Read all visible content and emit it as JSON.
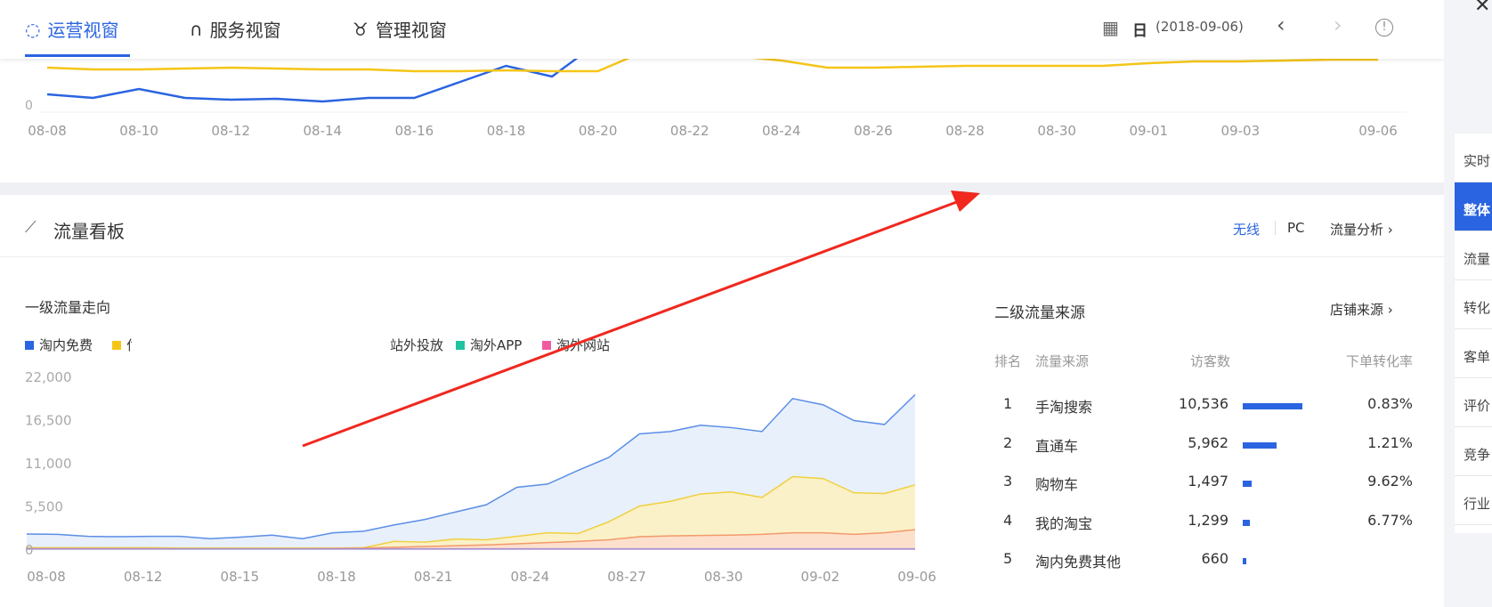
{
  "tabs": [
    {
      "label": "运营视窗",
      "icon": "refresh-circle-icon"
    },
    {
      "label": "服务视窗",
      "icon": "headset-icon"
    },
    {
      "label": "管理视窗",
      "icon": "tie-icon"
    }
  ],
  "date": {
    "period": "日",
    "value": "(2018-09-06)",
    "icon": "calendar-icon"
  },
  "close_icon": "close-icon",
  "top_chart": {
    "type": "line",
    "zero_label": "0",
    "x_labels": [
      "08-08",
      "08-10",
      "08-12",
      "08-14",
      "08-16",
      "08-18",
      "08-20",
      "08-22",
      "08-24",
      "08-26",
      "08-28",
      "08-30",
      "09-01",
      "09-03",
      "09-06"
    ],
    "series": [
      {
        "name": "blue",
        "color": "#2a64e0",
        "values": [
          12,
          8,
          18,
          8,
          6,
          7,
          4,
          8,
          8,
          26,
          44,
          32,
          70,
          90,
          90,
          90,
          90,
          90,
          90,
          90,
          90,
          90,
          90,
          90,
          90,
          90,
          90,
          90,
          90,
          90
        ]
      },
      {
        "name": "yellow",
        "color": "#f5c518",
        "values": [
          42,
          40,
          40,
          41,
          42,
          41,
          40,
          40,
          38,
          38,
          39,
          38,
          38,
          60,
          58,
          55,
          50,
          42,
          42,
          43,
          44,
          44,
          44,
          44,
          47,
          49,
          49,
          50,
          51,
          51
        ]
      }
    ],
    "ylim": [
      0,
      60
    ]
  },
  "section": {
    "title": "流量看板",
    "wireless": "无线",
    "pc": "PC",
    "analysis": "流量分析 ›"
  },
  "chart_data": {
    "type": "area",
    "title": "一级流量走向",
    "legend": [
      {
        "label": "淘内免费",
        "color": "#2a64e0"
      },
      {
        "label": "付",
        "color": "#f5c518"
      },
      {
        "label": "站外投放",
        "color": "#f08a4b"
      },
      {
        "label": "淘外APP",
        "color": "#1ec4a0"
      },
      {
        "label": "淘外网站",
        "color": "#f05aa0"
      }
    ],
    "yticks": [
      "22,000",
      "16,500",
      "11,000",
      "5,500",
      "0"
    ],
    "ylim": [
      0,
      22000
    ],
    "xticks": [
      "08-08",
      "08-12",
      "08-15",
      "08-18",
      "08-21",
      "08-24",
      "08-27",
      "08-30",
      "09-02",
      "09-06"
    ],
    "series": [
      {
        "name": "淘内免费",
        "color": "#5b8ee6",
        "fill": "#e8f0fb",
        "values": [
          2040,
          2000,
          1750,
          1700,
          1750,
          1750,
          1450,
          1650,
          1900,
          1450,
          2200,
          2400,
          3200,
          3900,
          4850,
          5770,
          8000,
          8400,
          10150,
          11800,
          14800,
          15100,
          15900,
          15600,
          15100,
          19300,
          18500,
          16500,
          16000,
          19800
        ]
      },
      {
        "name": "付费",
        "color": "#f0d040",
        "fill": "#fbf1c8",
        "values": [
          300,
          300,
          300,
          300,
          300,
          250,
          250,
          250,
          250,
          250,
          250,
          300,
          1100,
          1000,
          1400,
          1300,
          1750,
          2200,
          2100,
          3600,
          5600,
          6200,
          7150,
          7400,
          6700,
          9350,
          9100,
          7300,
          7200,
          8300
        ]
      },
      {
        "name": "站外投放",
        "color": "#f29a6a",
        "fill": "#fde0cc",
        "values": [
          200,
          200,
          200,
          200,
          200,
          150,
          150,
          150,
          150,
          150,
          200,
          250,
          350,
          450,
          550,
          650,
          800,
          950,
          1100,
          1300,
          1700,
          1800,
          1850,
          1900,
          2000,
          2200,
          2200,
          2000,
          2200,
          2600
        ]
      },
      {
        "name": "淘外网站",
        "color": "#a890d0",
        "fill": "#d8cdea",
        "values": [
          150,
          150,
          150,
          150,
          150,
          150,
          150,
          150,
          150,
          150,
          150,
          150,
          150,
          150,
          150,
          150,
          150,
          150,
          150,
          150,
          150,
          150,
          150,
          150,
          150,
          150,
          150,
          150,
          150,
          150
        ]
      }
    ]
  },
  "sources": {
    "title": "二级流量来源",
    "link": "店铺来源 ›",
    "headers": [
      "排名",
      "流量来源",
      "访客数",
      "下单转化率"
    ],
    "rows": [
      {
        "rank": "1",
        "name": "手淘搜索",
        "visitors": "10,536",
        "v": 10536,
        "rate": "0.83%"
      },
      {
        "rank": "2",
        "name": "直通车",
        "visitors": "5,962",
        "v": 5962,
        "rate": "1.21%"
      },
      {
        "rank": "3",
        "name": "购物车",
        "visitors": "1,497",
        "v": 1497,
        "rate": "9.62%"
      },
      {
        "rank": "4",
        "name": "我的淘宝",
        "visitors": "1,299",
        "v": 1299,
        "rate": "6.77%"
      },
      {
        "rank": "5",
        "name": "淘内免费其他",
        "visitors": "660",
        "v": 660,
        "rate": ""
      }
    ]
  },
  "sidebar": [
    "实时",
    "整体",
    "流量",
    "转化",
    "客单",
    "评价",
    "竞争",
    "行业"
  ]
}
